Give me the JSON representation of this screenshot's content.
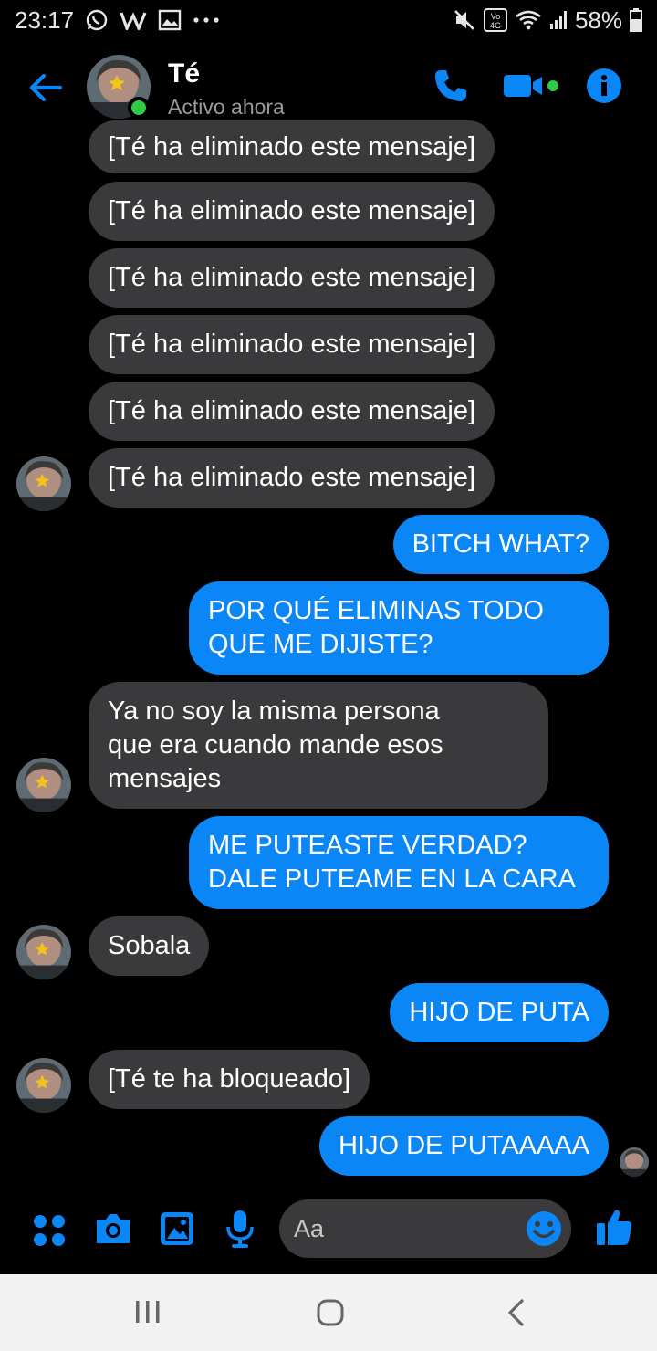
{
  "status_bar": {
    "time": "23:17",
    "battery": "58%",
    "left_icons": [
      "whatsapp-icon",
      "wordpress-icon",
      "gallery-icon",
      "more-dots-icon"
    ],
    "right_icons": [
      "mute-icon",
      "volte-4g-icon",
      "wifi-icon",
      "signal-icon",
      "battery-icon"
    ]
  },
  "header": {
    "contact_name": "Té",
    "status": "Activo ahora",
    "accent": "#0b86f6",
    "online_color": "#31cc46"
  },
  "messages": [
    {
      "side": "in",
      "text": "[Té ha eliminado este mensaje]"
    },
    {
      "side": "in",
      "text": "[Té ha eliminado este mensaje]"
    },
    {
      "side": "in",
      "text": "[Té ha eliminado este mensaje]"
    },
    {
      "side": "in",
      "text": "[Té ha eliminado este mensaje]"
    },
    {
      "side": "in",
      "text": "[Té ha eliminado este mensaje]"
    },
    {
      "side": "in",
      "text": "[Té ha eliminado este mensaje]"
    },
    {
      "side": "out",
      "text": "BITCH WHAT?"
    },
    {
      "side": "out",
      "lines": [
        "POR QUÉ ELIMINAS TODO",
        "QUE ME DIJISTE?"
      ]
    },
    {
      "side": "in",
      "lines": [
        "Ya no soy la misma persona",
        "que era cuando mande esos",
        "mensajes"
      ]
    },
    {
      "side": "out",
      "lines": [
        "ME PUTEASTE VERDAD?",
        "DALE PUTEAME EN LA CARA"
      ]
    },
    {
      "side": "in",
      "text": "Sobala"
    },
    {
      "side": "out",
      "text": "HIJO DE PUTA"
    },
    {
      "side": "in",
      "text": "[Té te ha bloqueado]"
    },
    {
      "side": "out",
      "text": "HIJO DE PUTAAAAA"
    }
  ],
  "composer": {
    "placeholder": "Aa",
    "icons": [
      "apps-grid-icon",
      "camera-icon",
      "image-icon",
      "microphone-icon",
      "emoji-icon",
      "thumbs-up-icon"
    ]
  },
  "nav_bar": {
    "icons": [
      "recent-apps-icon",
      "home-icon",
      "back-icon"
    ]
  }
}
